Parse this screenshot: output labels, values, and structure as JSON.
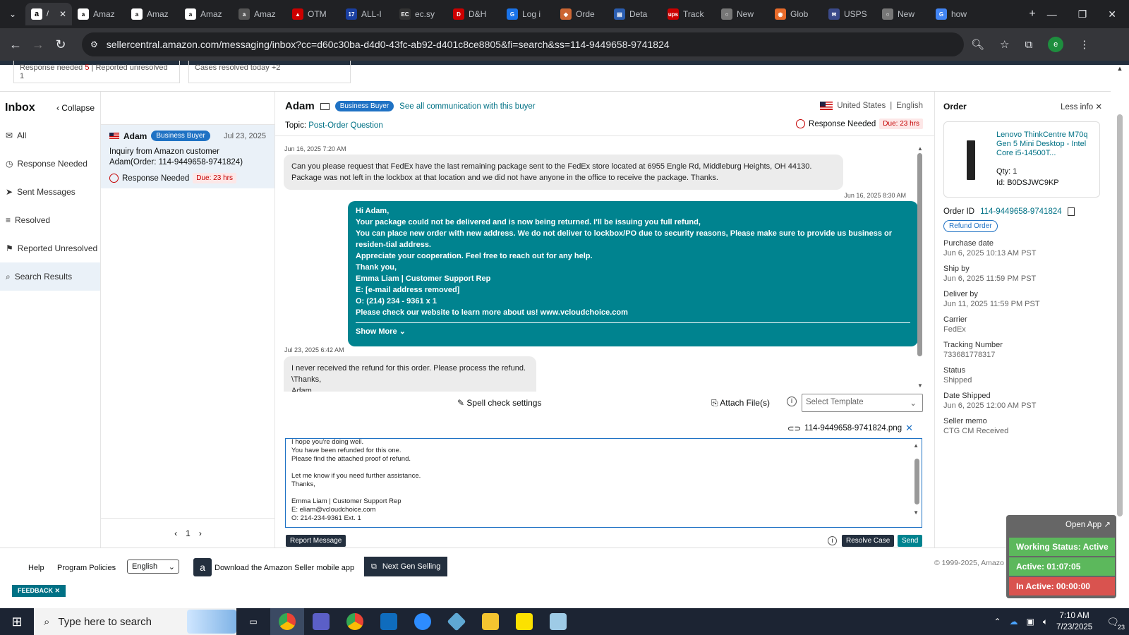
{
  "browser": {
    "tabs": [
      "Amaz",
      "Amaz",
      "Amaz",
      "Amaz",
      "OTM",
      "ALL-I",
      "ec.sy",
      "D&H",
      "Log i",
      "Orde",
      "Deta",
      "Track",
      "New",
      "Glob",
      "USPS",
      "New",
      "how"
    ],
    "url": "sellercentral.amazon.com/messaging/inbox?cc=d60c30ba-d4d0-43fc-ab92-d401c8ce8805&fi=search&ss=114-9449658-9741824",
    "profile_letter": "e"
  },
  "stats": {
    "response_needed_label": "Response needed",
    "response_needed_count": "5",
    "reported_unresolved_label": "Reported unresolved",
    "reported_unresolved_count": "1",
    "cases_resolved_label": "Cases resolved today",
    "cases_resolved_count": "+2"
  },
  "inbox": {
    "title": "Inbox",
    "collapse": "Collapse",
    "nav": [
      "All",
      "Response Needed",
      "Sent Messages",
      "Resolved",
      "Reported Unresolved",
      "Search Results"
    ]
  },
  "conversation_item": {
    "name": "Adam",
    "badge": "Business Buyer",
    "date": "Jul 23, 2025",
    "subject": "Inquiry from Amazon customer Adam(Order: 114-9449658-9741824)",
    "status": "Response Needed",
    "due": "Due: 23 hrs"
  },
  "pagination": {
    "page": "1"
  },
  "thread": {
    "buyer": "Adam",
    "badge": "Business Buyer",
    "see_all": "See all communication with this buyer",
    "country": "United States",
    "language": "English",
    "topic_label": "Topic:",
    "topic": "Post-Order Question",
    "status": "Response Needed",
    "due": "Due: 23 hrs",
    "messages": [
      {
        "ts": "Jun 16, 2025 7:20 AM",
        "text": "Can you please request that FedEx have the last remaining package sent to the FedEx store located at  6955 Engle Rd, Middleburg Heights, OH 44130. Package was not left in the lockbox at that location and we did not have anyone in the office to receive the package. Thanks."
      },
      {
        "ts": "Jun 16, 2025 8:30 AM",
        "lines": [
          "Hi Adam,",
          "Your package could not be delivered and is now being returned. I'll be issuing you full refund,",
          "You can place new order with new address. We do not deliver to lockbox/PO due to security reasons, Please make sure to provide us business or residen-tial address.",
          "Appreciate your cooperation. Feel free to reach out for any help.",
          "Thank you,",
          "Emma Liam | Customer Support Rep",
          "E: [e-mail address removed]",
          "O: (214) 234 - 9361 x  1",
          "Please check our website to learn more about us! www.vcloudchoice.com"
        ],
        "show_more": "Show More"
      },
      {
        "ts": "Jul 23, 2025 6:42 AM",
        "lines": [
          "I never received the refund for this order. Please process the refund.",
          "\\Thanks,",
          "Adam"
        ]
      }
    ]
  },
  "composer": {
    "spell_check": "Spell check settings",
    "attach": "Attach File(s)",
    "template_placeholder": "Select Template",
    "attachment": "114-9449658-9741824.png",
    "draft_lines": [
      "I hope you're doing well.",
      "You have been refunded for this one.",
      "Please find the attached proof of refund.",
      "",
      "Let me know if you need further assistance.",
      "Thanks,",
      "",
      "Emma Liam | Customer Support Rep",
      "E: eliam@vcloudchoice.com",
      "O: 214-234-9361 Ext. 1"
    ],
    "report": "Report Message",
    "resolve": "Resolve Case",
    "send": "Send"
  },
  "order": {
    "title": "Order",
    "less_info": "Less info",
    "product": "Lenovo ThinkCentre M70q Gen 5 Mini Desktop - Intel Core i5-14500T...",
    "qty": "Qty: 1",
    "id": "Id: B0DSJWC9KP",
    "order_id_label": "Order ID",
    "order_id": "114-9449658-9741824",
    "refund": "Refund Order",
    "fields": [
      {
        "label": "Purchase date",
        "value": "Jun 6, 2025 10:13 AM PST"
      },
      {
        "label": "Ship by",
        "value": "Jun 6, 2025 11:59 PM PST"
      },
      {
        "label": "Deliver by",
        "value": "Jun 11, 2025 11:59 PM PST"
      },
      {
        "label": "Carrier",
        "value": "FedEx"
      },
      {
        "label": "Tracking Number",
        "value": "733681778317"
      },
      {
        "label": "Status",
        "value": "Shipped"
      },
      {
        "label": "Date Shipped",
        "value": "Jun 6, 2025 12:00 AM PST"
      },
      {
        "label": "Seller memo",
        "value": "CTG CM Received"
      }
    ]
  },
  "footer": {
    "help": "Help",
    "policies": "Program Policies",
    "language": "English",
    "mobile": "Download the Amazon Seller mobile app",
    "next_gen": "Next Gen Selling",
    "copyright": "© 1999-2025, Amazo",
    "feedback": "FEEDBACK"
  },
  "widget": {
    "open_app": "Open App",
    "working": "Working Status: Active",
    "active": "Active: 01:07:05",
    "inactive": "In Active: 00:00:00"
  },
  "taskbar": {
    "search": "Type here to search",
    "time": "7:10 AM",
    "date": "7/23/2025",
    "notif": "23"
  },
  "colors": {
    "teal": "#00838f",
    "badge_blue": "#1f72c4",
    "link": "#007185",
    "active_green": "#5cb85c",
    "inactive_red": "#d9534f"
  }
}
